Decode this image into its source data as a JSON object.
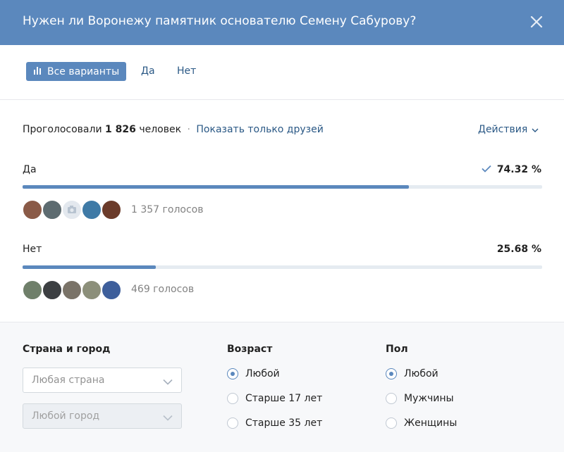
{
  "header": {
    "title": "Нужен ли Воронежу памятник основателю Семену Сабурову?"
  },
  "tabs": [
    {
      "label": "Все варианты",
      "active": true
    },
    {
      "label": "Да",
      "active": false
    },
    {
      "label": "Нет",
      "active": false
    }
  ],
  "summary": {
    "voted_prefix": "Проголосовали",
    "count": "1 826",
    "people": "человек",
    "separator": "·",
    "friends_link": "Показать только друзей",
    "actions": "Действия"
  },
  "options": [
    {
      "label": "Да",
      "percent_text": "74.32 %",
      "percent": 74.32,
      "checked": true,
      "votes_text": "1 357 голосов"
    },
    {
      "label": "Нет",
      "percent_text": "25.68 %",
      "percent": 25.68,
      "checked": false,
      "votes_text": "469 голосов"
    }
  ],
  "filters": {
    "location": {
      "heading": "Страна и город",
      "country": "Любая страна",
      "city": "Любой город"
    },
    "age": {
      "heading": "Возраст",
      "options": [
        "Любой",
        "Старше 17 лет",
        "Старше 35 лет"
      ],
      "selected": 0
    },
    "gender": {
      "heading": "Пол",
      "options": [
        "Любой",
        "Мужчины",
        "Женщины"
      ],
      "selected": 0
    }
  },
  "colors": {
    "accent": "#5b88bd",
    "link": "#2a5885",
    "bar_track": "#e5ebf1"
  }
}
